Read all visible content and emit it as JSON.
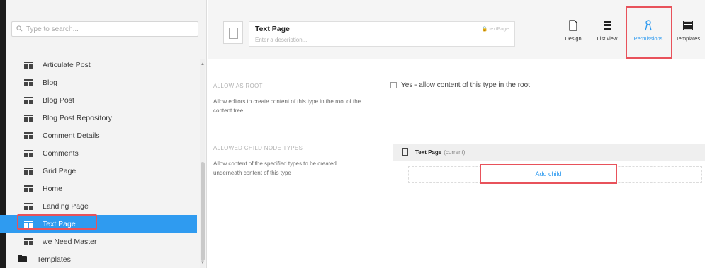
{
  "sidebar": {
    "search": {
      "placeholder": "Type to search..."
    },
    "items": [
      {
        "label": "Articulate Post"
      },
      {
        "label": "Blog"
      },
      {
        "label": "Blog Post"
      },
      {
        "label": "Blog Post Repository"
      },
      {
        "label": "Comment Details"
      },
      {
        "label": "Comments"
      },
      {
        "label": "Grid Page"
      },
      {
        "label": "Home"
      },
      {
        "label": "Landing Page"
      },
      {
        "label": "Text Page",
        "selected": true
      },
      {
        "label": "we Need Master"
      }
    ],
    "folder": {
      "label": "Templates"
    }
  },
  "header": {
    "name": "Text Page",
    "description_placeholder": "Enter a description...",
    "alias": "textPage",
    "toolbar": [
      {
        "label": "Design",
        "icon": "document-icon"
      },
      {
        "label": "List view",
        "icon": "list-icon"
      },
      {
        "label": "Permissions",
        "icon": "key-icon",
        "active": true
      },
      {
        "label": "Templates",
        "icon": "template-icon"
      }
    ]
  },
  "permissions": {
    "allow_root": {
      "title": "ALLOW AS ROOT",
      "description": "Allow editors to create content of this type in the root of the content tree",
      "checkbox_label": "Yes - allow content of this type in the root"
    },
    "child_types": {
      "title": "ALLOWED CHILD NODE TYPES",
      "description": "Allow content of the specified types to be created underneath content of this type",
      "current_name": "Text Page",
      "current_suffix": "(current)",
      "add_child_label": "Add child"
    }
  },
  "colors": {
    "accent": "#2f9bf0",
    "highlight": "#e8525b"
  }
}
